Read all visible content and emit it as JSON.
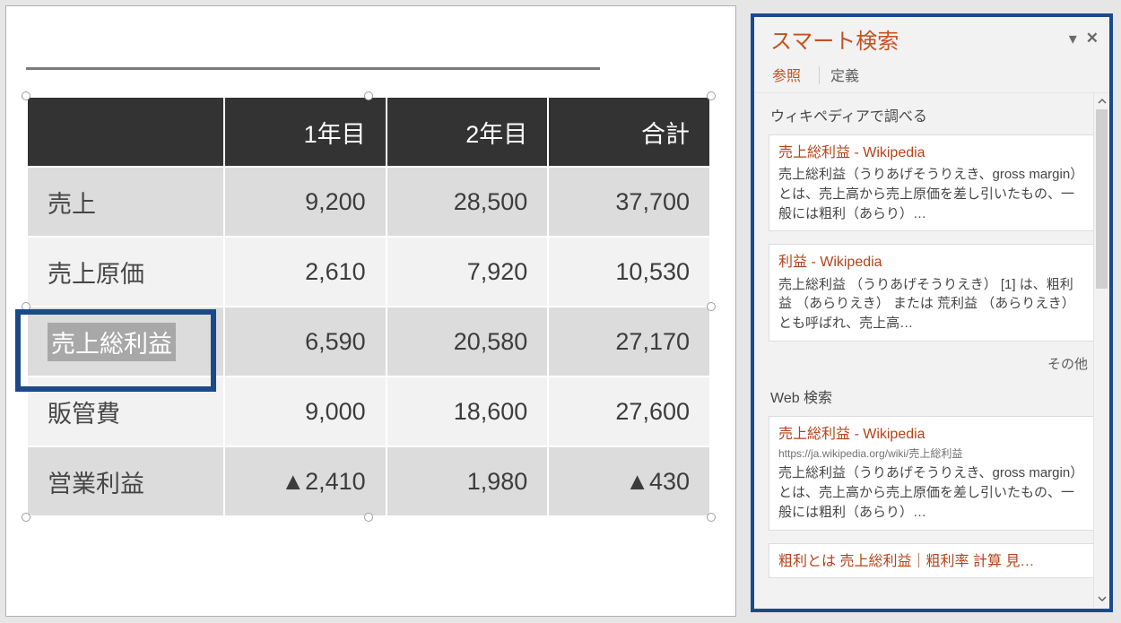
{
  "chart_data": {
    "type": "table",
    "columns": [
      "",
      "1年目",
      "2年目",
      "合計"
    ],
    "rows": [
      {
        "label": "売上",
        "y1": "9,200",
        "y2": "28,500",
        "total": "37,700"
      },
      {
        "label": "売上原価",
        "y1": "2,610",
        "y2": "7,920",
        "total": "10,530"
      },
      {
        "label": "売上総利益",
        "y1": "6,590",
        "y2": "20,580",
        "total": "27,170"
      },
      {
        "label": "販管費",
        "y1": "9,000",
        "y2": "18,600",
        "total": "27,600"
      },
      {
        "label": "営業利益",
        "y1": "▲2,410",
        "y2": "1,980",
        "total": "▲430"
      }
    ],
    "selected_row_index": 2
  },
  "pane": {
    "title": "スマート検索",
    "tabs": {
      "reference": "参照",
      "definition": "定義"
    },
    "sections": {
      "wiki_label": "ウィキペディアで調べる",
      "web_label": "Web 検索",
      "more": "その他"
    },
    "results": {
      "wiki": [
        {
          "title": "売上総利益 - Wikipedia",
          "snippet": "売上総利益（うりあげそうりえき、gross margin）とは、売上高から売上原価を差し引いたもの、一般には粗利（あらり）…"
        },
        {
          "title": "利益 - Wikipedia",
          "snippet": "売上総利益 （うりあげそうりえき） [1] は、粗利益 （あらりえき） または 荒利益 （あらりえき） とも呼ばれ、売上高…"
        }
      ],
      "web": [
        {
          "title": "売上総利益 - Wikipedia",
          "url": "https://ja.wikipedia.org/wiki/売上総利益",
          "snippet": "売上総利益（うりあげそうりえき、gross margin）とは、売上高から売上原価を差し引いたもの、一般には粗利（あらり）…"
        },
        {
          "title": "粗利とは 売上総利益｜粗利率 計算 見…",
          "url": "",
          "snippet": ""
        }
      ]
    }
  }
}
